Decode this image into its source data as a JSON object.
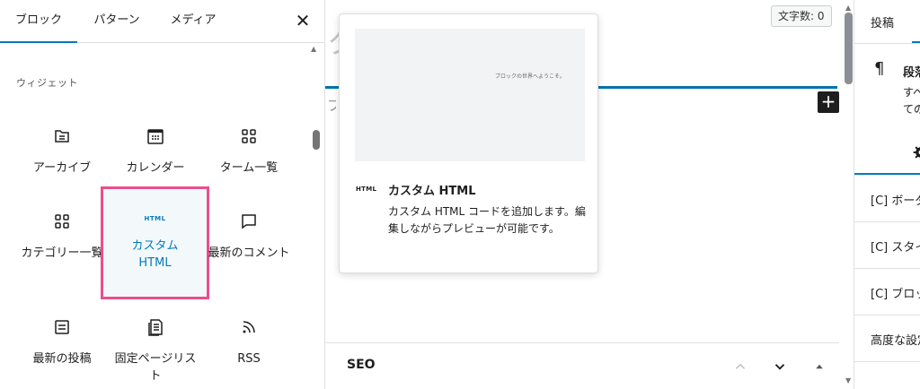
{
  "inserter": {
    "tabs": [
      "ブロック",
      "パターン",
      "メディア"
    ],
    "close_label": "✕",
    "category_heading": "ウィジェット",
    "blocks": [
      {
        "label": "アーカイブ",
        "icon": "archive-icon"
      },
      {
        "label": "カレンダー",
        "icon": "calendar-icon"
      },
      {
        "label": "ターム一覧",
        "icon": "tag-cloud-icon"
      },
      {
        "label": "カテゴリー一覧",
        "icon": "categories-icon"
      },
      {
        "label": "カスタム HTML",
        "icon": "html-icon",
        "glyph": "HTML"
      },
      {
        "label": "最新のコメント",
        "icon": "comment-icon"
      },
      {
        "label": "最新の投稿",
        "icon": "post-list-icon"
      },
      {
        "label": "固定ページリスト",
        "icon": "page-list-icon"
      },
      {
        "label": "RSS",
        "icon": "rss-icon"
      }
    ]
  },
  "editor": {
    "word_count": "文字数: 0",
    "add_block_label": "+",
    "seo_label": "SEO"
  },
  "preview": {
    "sample_text": "ブロックの世界へようこそ。",
    "icon_glyph": "HTML",
    "title": "カスタム HTML",
    "description": "カスタム HTML コードを追加します。編集しながらプレビューが可能です。"
  },
  "sidebar": {
    "tab_label": "投稿",
    "block_icon_glyph": "¶",
    "block_title": "段落",
    "block_description": "すべてのブロックの最初のステップです。",
    "panels": [
      "[C] ボーダー",
      "[C] スタイル",
      "[C] ブロック",
      "高度な設定"
    ]
  },
  "colors": {
    "accent": "#007cba",
    "selection_border": "#ea4f8c",
    "selected_bg": "#f3f8fb"
  }
}
